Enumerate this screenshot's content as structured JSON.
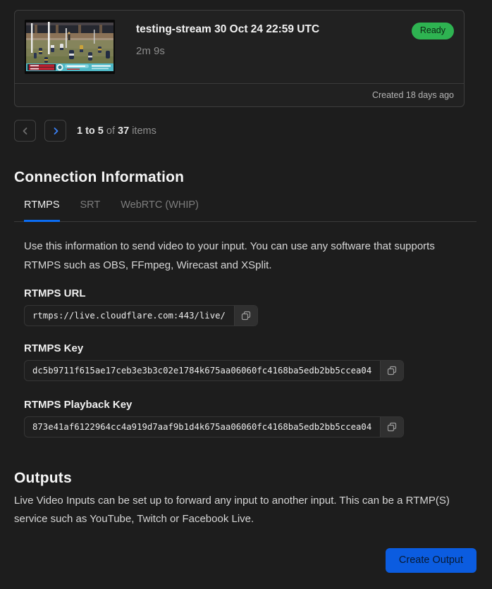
{
  "colors": {
    "page_bg": "#1d1d1d",
    "accent_blue": "#0b6cf2",
    "button_blue": "#0b5ce0",
    "badge_green": "#2eb351"
  },
  "video_card": {
    "title": "testing-stream 30 Oct 24 22:59 UTC",
    "duration": "2m 9s",
    "status": "Ready",
    "created": "Created 18 days ago"
  },
  "pagination": {
    "range": "1 to 5",
    "of_label": "of",
    "total": "37",
    "items_label": "items"
  },
  "connection": {
    "heading": "Connection Information",
    "tabs": [
      {
        "label": "RTMPS"
      },
      {
        "label": "SRT"
      },
      {
        "label": "WebRTC (WHIP)"
      }
    ],
    "description": "Use this information to send video to your input. You can use any software that supports RTMPS such as OBS, FFmpeg, Wirecast and XSplit.",
    "fields": [
      {
        "label": "RTMPS URL",
        "value": "rtmps://live.cloudflare.com:443/live/"
      },
      {
        "label": "RTMPS Key",
        "value": "dc5b9711f615ae17ceb3e3b3c02e1784k675aa06060fc4168ba5edb2bb5ccea04"
      },
      {
        "label": "RTMPS Playback Key",
        "value": "873e41af6122964cc4a919d7aaf9b1d4k675aa06060fc4168ba5edb2bb5ccea04"
      }
    ]
  },
  "outputs": {
    "heading": "Outputs",
    "description": "Live Video Inputs can be set up to forward any input to another input. This can be a RTMP(S) service such as YouTube, Twitch or Facebook Live.",
    "create_button": "Create Output"
  }
}
